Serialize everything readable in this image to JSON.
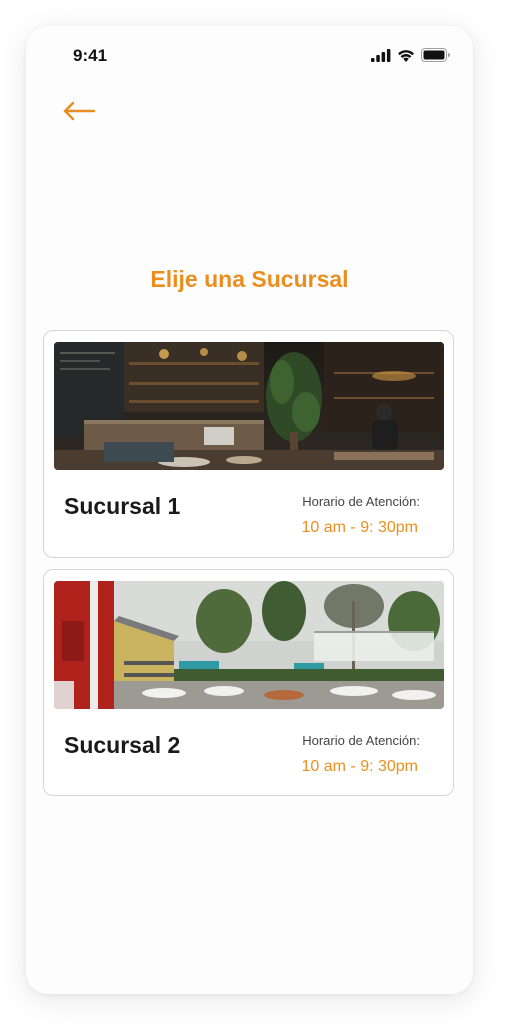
{
  "colors": {
    "accent": "#ea8f1f",
    "text": "#1a1a1a"
  },
  "status_bar": {
    "time": "9:41",
    "icons": [
      "signal-icon",
      "wifi-icon",
      "battery-icon"
    ]
  },
  "header": {
    "back_icon": "arrow-left-icon",
    "title": "Elije una Sucursal"
  },
  "branches": [
    {
      "name": "Sucursal 1",
      "hours_label": "Horario de Atención:",
      "hours": "10 am - 9: 30pm",
      "image": "cafe-interior-photo"
    },
    {
      "name": "Sucursal 2",
      "hours_label": "Horario de Atención:",
      "hours": "10 am - 9: 30pm",
      "image": "outdoor-terrace-photo"
    }
  ]
}
